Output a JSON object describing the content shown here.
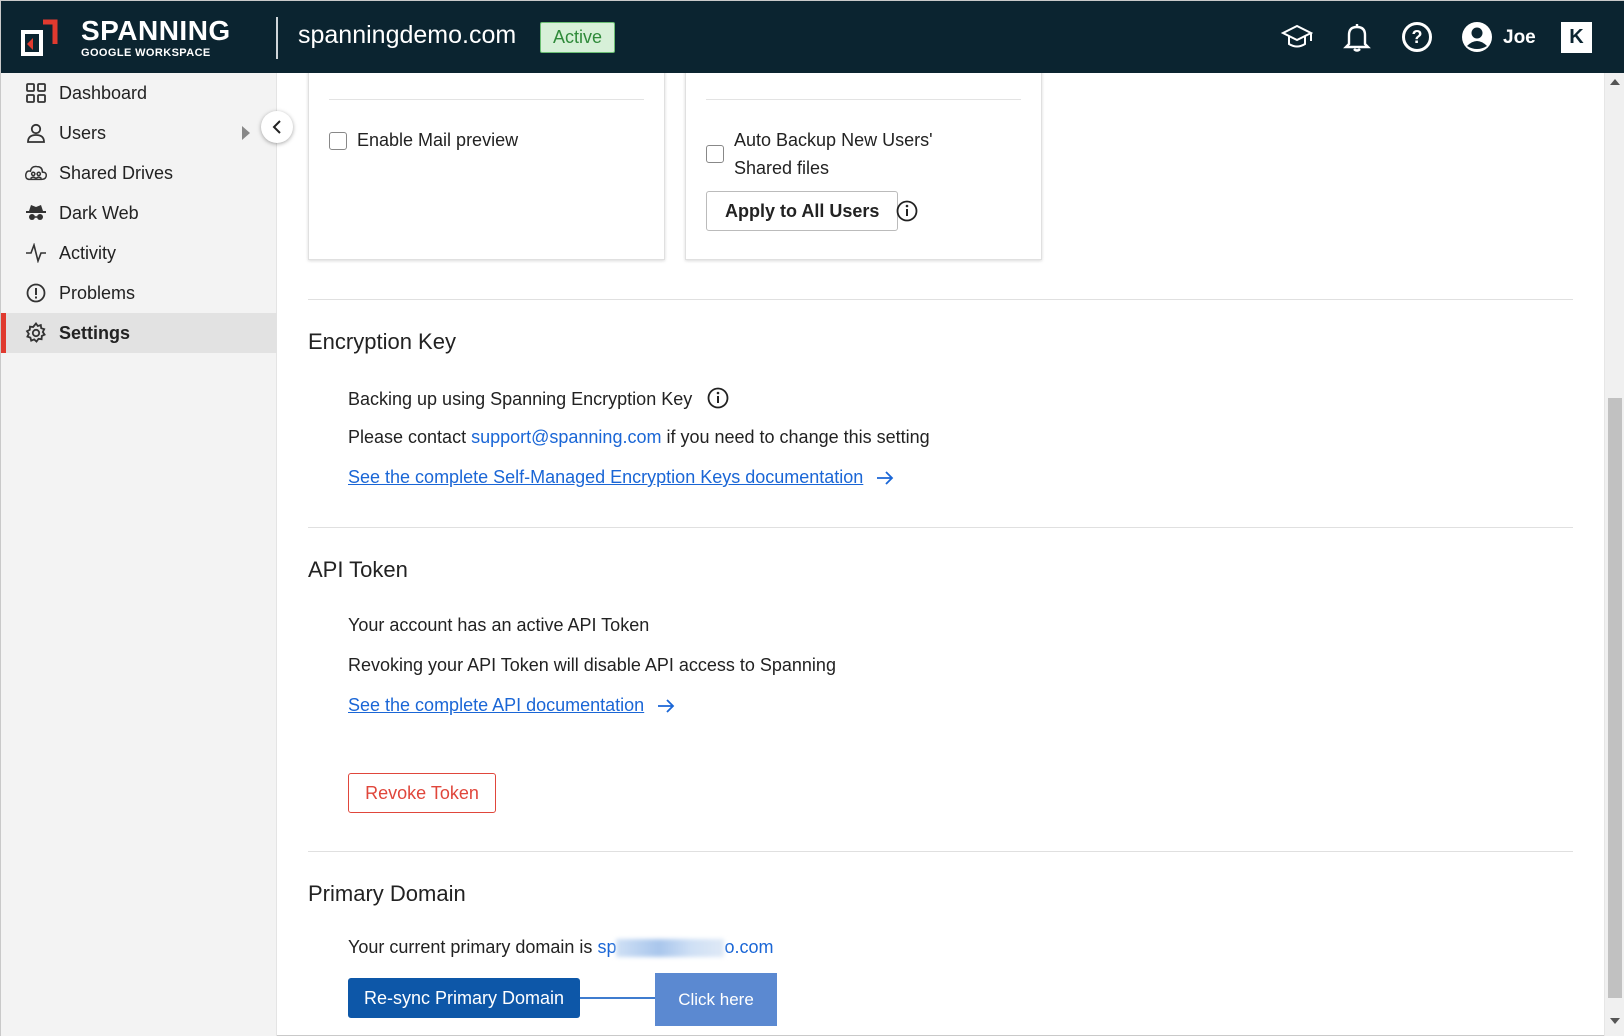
{
  "header": {
    "logo_title": "SPANNING",
    "logo_subtitle": "GOOGLE WORKSPACE",
    "domain": "spanningdemo.com",
    "status": "Active",
    "user_name": "Joe",
    "brand_mark": "K",
    "icons": [
      "graduation-cap-icon",
      "bell-icon",
      "help-icon",
      "user-avatar-icon"
    ],
    "colors": {
      "background": "#0b2430",
      "status_bg": "#d7f0d8",
      "status_text": "#2f8a3a"
    }
  },
  "sidebar": {
    "items": [
      {
        "label": "Dashboard",
        "icon": "grid-icon"
      },
      {
        "label": "Users",
        "icon": "user-icon"
      },
      {
        "label": "Shared Drives",
        "icon": "shared-drive-icon"
      },
      {
        "label": "Dark Web",
        "icon": "spy-icon"
      },
      {
        "label": "Activity",
        "icon": "activity-icon"
      },
      {
        "label": "Problems",
        "icon": "alert-icon"
      },
      {
        "label": "Settings",
        "icon": "gear-icon"
      }
    ],
    "active": "Settings",
    "accent_color": "#e03a2f"
  },
  "cards": {
    "mail_preview_label": "Enable Mail preview",
    "auto_backup_label": "Auto Backup New Users' Shared files",
    "apply_all_label": "Apply to All Users"
  },
  "encryption": {
    "title": "Encryption Key",
    "line1": "Backing up using Spanning Encryption Key",
    "line2_prefix": "Please contact ",
    "line2_email": "support@spanning.com",
    "line2_suffix": " if you need to change this setting",
    "doc_link": "See the complete Self-Managed Encryption Keys documentation"
  },
  "api_token": {
    "title": "API Token",
    "line1": "Your account has an active API Token",
    "line2": "Revoking your API Token will disable API access to Spanning",
    "doc_link": "See the complete API documentation",
    "revoke_label": "Revoke Token"
  },
  "primary_domain": {
    "title": "Primary Domain",
    "prefix": "Your current primary domain is ",
    "domain_start": "sp",
    "domain_end": "o.com",
    "resync_label": "Re-sync Primary Domain",
    "callout": "Click here"
  }
}
